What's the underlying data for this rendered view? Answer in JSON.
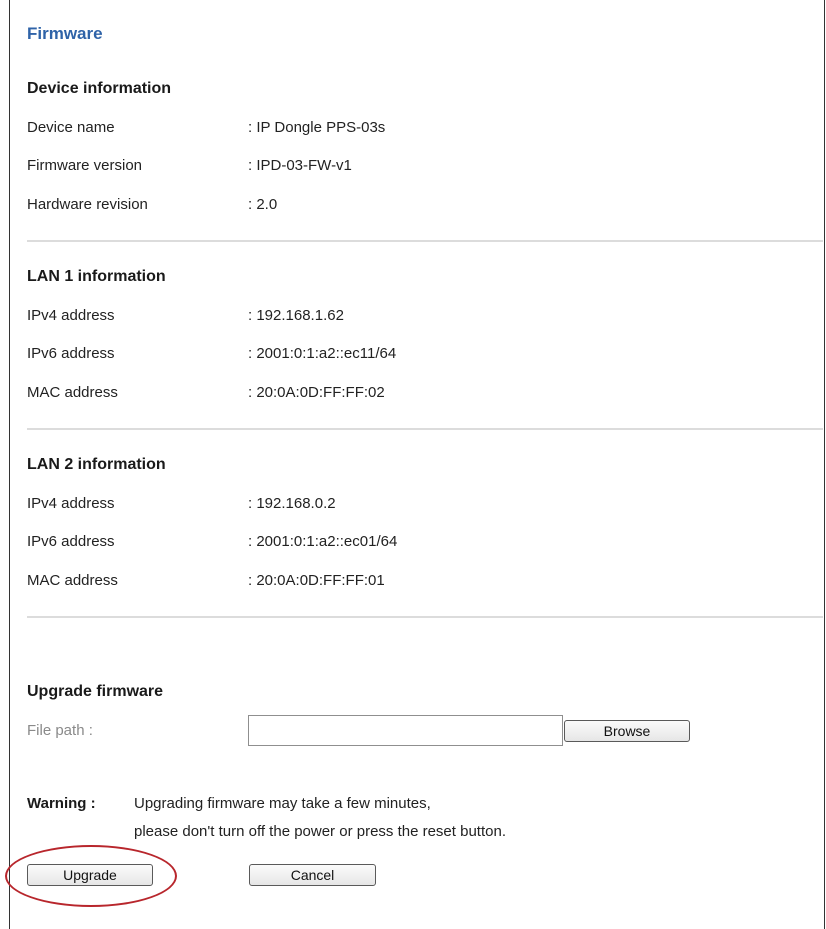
{
  "page": {
    "title": "Firmware"
  },
  "device": {
    "heading": "Device information",
    "rows": [
      {
        "label": "Device name",
        "value": ": IP Dongle PPS-03s"
      },
      {
        "label": "Firmware version",
        "value": ": IPD-03-FW-v1"
      },
      {
        "label": "Hardware revision",
        "value": ": 2.0"
      }
    ]
  },
  "lan1": {
    "heading": "LAN 1 information",
    "rows": [
      {
        "label": "IPv4 address",
        "value": ": 192.168.1.62"
      },
      {
        "label": "IPv6 address",
        "value": ": 2001:0:1:a2::ec11/64"
      },
      {
        "label": "MAC address",
        "value": ": 20:0A:0D:FF:FF:02"
      }
    ]
  },
  "lan2": {
    "heading": "LAN 2 information",
    "rows": [
      {
        "label": "IPv4 address",
        "value": ": 192.168.0.2"
      },
      {
        "label": "IPv6 address",
        "value": ": 2001:0:1:a2::ec01/64"
      },
      {
        "label": "MAC address",
        "value": ": 20:0A:0D:FF:FF:01"
      }
    ]
  },
  "upgrade": {
    "heading": "Upgrade firmware",
    "file_label": "File path :",
    "file_value": "",
    "browse_label": "Browse",
    "warning_key": "Warning :",
    "warning_lines": [
      "Upgrading firmware may take a few minutes,",
      "please don't turn off the power or press the reset button."
    ],
    "upgrade_label": "Upgrade",
    "cancel_label": "Cancel"
  },
  "colors": {
    "title": "#2f63a8",
    "highlight": "#b8262c",
    "divider": "#dcdcdc"
  }
}
